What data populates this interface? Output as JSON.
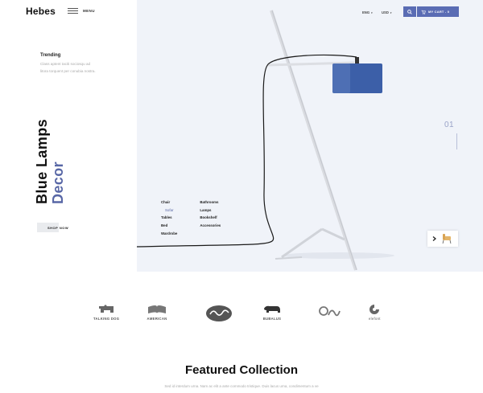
{
  "header": {
    "logo": "Hebes",
    "menu_label": "MENU",
    "language": "ENG",
    "currency": "USD",
    "cart_label": "MY CART - 0"
  },
  "trending": {
    "title": "Trending",
    "text_line1": "Class aptent taciti sociosqu ad",
    "text_line2": "litora torquent per conubia nostra."
  },
  "hero": {
    "title_line1": "Blue Lamps",
    "title_line2": "Decor",
    "shop_now": "SHOP NOW",
    "slide_number": "01",
    "categories_col1": [
      "Chair",
      "Sofar",
      "Tables",
      "Bed",
      "Wardrobe"
    ],
    "categories_col2": [
      "Bathrooms",
      "Lamps",
      "Bookshelf",
      "Accessories"
    ],
    "active_category": "Sofar"
  },
  "brands": [
    {
      "name": "TALKING DOG",
      "icon": "dog-logo-icon"
    },
    {
      "name": "AMERICAN",
      "icon": "book-logo-icon"
    },
    {
      "name": "",
      "icon": "script-badge-logo-icon"
    },
    {
      "name": "BUBALUS",
      "icon": "buffalo-logo-icon"
    },
    {
      "name": "",
      "icon": "folka-logo-icon"
    },
    {
      "name": "elefont",
      "icon": "elephant-logo-icon"
    }
  ],
  "featured": {
    "title": "Featured Collection",
    "subtitle": "Sed id interdum urna. Nam ac elit a ante commodo tristique. Duis lacus urna, condimentum a ve"
  },
  "colors": {
    "accent": "#5a6cb4",
    "hero_bg": "#f0f3f9",
    "lamp_shade": "#3c5fa8",
    "title_dark": "#111111",
    "title_accent": "#5867a6"
  }
}
